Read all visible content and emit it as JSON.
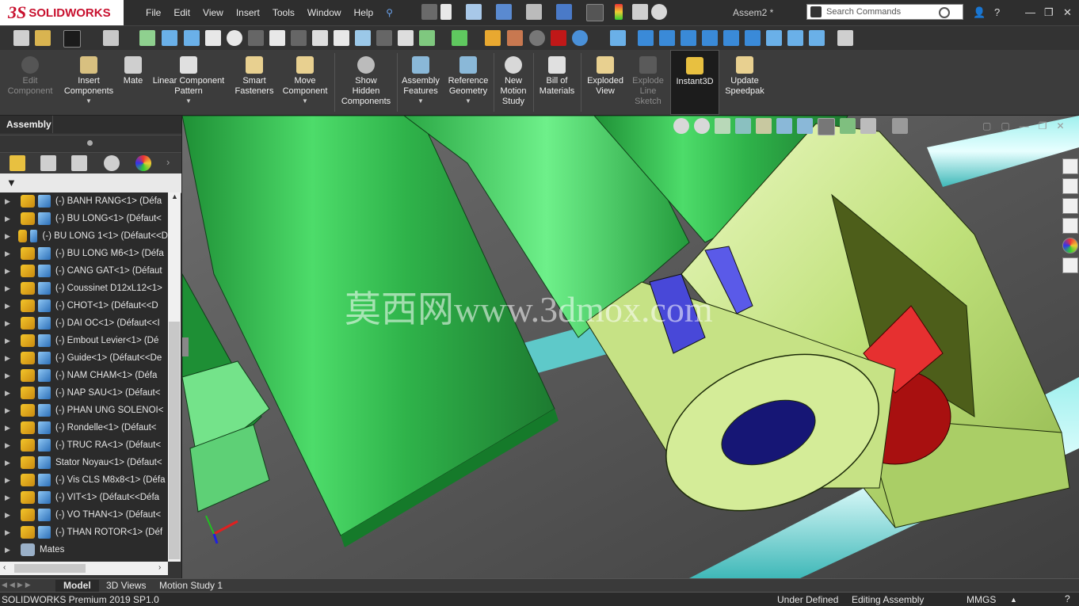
{
  "app": {
    "brand_ds": "3S",
    "brand_name": "SOLIDWORKS",
    "doc_title": "Assem2 *"
  },
  "menu": [
    "File",
    "Edit",
    "View",
    "Insert",
    "Tools",
    "Window",
    "Help"
  ],
  "search": {
    "placeholder": "Search Commands"
  },
  "command_manager": [
    {
      "label": "Edit\nComponent",
      "disabled": true,
      "has_arrow": false
    },
    {
      "label": "Insert\nComponents",
      "disabled": false,
      "has_arrow": true
    },
    {
      "label": "Mate",
      "disabled": false,
      "has_arrow": false
    },
    {
      "label": "Linear Component\nPattern",
      "disabled": false,
      "has_arrow": true
    },
    {
      "label": "Smart\nFasteners",
      "disabled": false,
      "has_arrow": false
    },
    {
      "label": "Move\nComponent",
      "disabled": false,
      "has_arrow": true
    },
    {
      "label": "Show\nHidden\nComponents",
      "disabled": false,
      "has_arrow": false
    },
    {
      "label": "Assembly\nFeatures",
      "disabled": false,
      "has_arrow": true
    },
    {
      "label": "Reference\nGeometry",
      "disabled": false,
      "has_arrow": true
    },
    {
      "label": "New\nMotion\nStudy",
      "disabled": false,
      "has_arrow": false
    },
    {
      "label": "Bill of\nMaterials",
      "disabled": false,
      "has_arrow": false
    },
    {
      "label": "Exploded\nView",
      "disabled": false,
      "has_arrow": false
    },
    {
      "label": "Explode\nLine\nSketch",
      "disabled": true,
      "has_arrow": false
    },
    {
      "label": "Instant3D",
      "disabled": false,
      "has_arrow": false
    },
    {
      "label": "Update\nSpeedpak",
      "disabled": false,
      "has_arrow": false
    }
  ],
  "panel": {
    "tab_label": "Assembly"
  },
  "tree": [
    {
      "label": "(-) BANH RANG<1> (Défa",
      "icon": "part-icon"
    },
    {
      "label": "(-) BU LONG<1> (Défaut<",
      "icon": "part-icon"
    },
    {
      "label": "(-) BU LONG 1<1> (Défaut<<D",
      "icon": "part-icon"
    },
    {
      "label": "(-) BU LONG M6<1> (Défa",
      "icon": "part-icon"
    },
    {
      "label": "(-) CANG GAT<1> (Défaut",
      "icon": "part-icon"
    },
    {
      "label": "(-) Coussinet D12xL12<1>",
      "icon": "part-icon"
    },
    {
      "label": "(-) CHOT<1> (Défaut<<D",
      "icon": "part-icon"
    },
    {
      "label": "(-) DAI OC<1> (Défaut<<I",
      "icon": "part-icon"
    },
    {
      "label": "(-) Embout Levier<1> (Dé",
      "icon": "part-icon"
    },
    {
      "label": "(-) Guide<1> (Défaut<<De",
      "icon": "part-icon"
    },
    {
      "label": "(-) NAM CHAM<1> (Défa",
      "icon": "part-icon"
    },
    {
      "label": "(-) NAP SAU<1> (Défaut<",
      "icon": "part-icon"
    },
    {
      "label": "(-) PHAN UNG SOLENOI<",
      "icon": "part-icon"
    },
    {
      "label": "(-) Rondelle<1> (Défaut<",
      "icon": "part-icon"
    },
    {
      "label": "(-) TRUC RA<1> (Défaut<",
      "icon": "part-icon"
    },
    {
      "label": "Stator Noyau<1> (Défaut<",
      "icon": "part-icon"
    },
    {
      "label": "(-) Vis CLS M8x8<1> (Défa",
      "icon": "part-icon"
    },
    {
      "label": "(-) VIT<1> (Défaut<<Défa",
      "icon": "part-icon"
    },
    {
      "label": "(-) VO THAN<1> (Défaut<",
      "icon": "part-icon"
    },
    {
      "label": "(-) THAN ROTOR<1> (Déf",
      "icon": "part-icon"
    },
    {
      "label": "Mates",
      "icon": "mates-icon"
    }
  ],
  "watermark": "莫西网www.3dmox.com",
  "bottom_tabs": [
    "Model",
    "3D Views",
    "Motion Study 1"
  ],
  "status": {
    "product": "SOLIDWORKS Premium 2019 SP1.0",
    "definition": "Under Defined",
    "mode": "Editing Assembly",
    "units": "MMGS"
  },
  "colors": {
    "brand": "#c8102e",
    "green": "#2fb34a",
    "lime": "#c8e88a",
    "red": "#d01818",
    "blue": "#3030c8"
  }
}
